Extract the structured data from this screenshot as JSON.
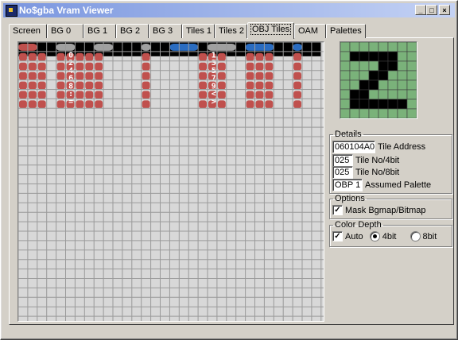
{
  "window": {
    "title": "No$gba Vram Viewer"
  },
  "titlebar_buttons": {
    "minimize": "_",
    "maximize": "□",
    "close": "×"
  },
  "tabs": [
    {
      "label": "Screen"
    },
    {
      "label": "BG 0"
    },
    {
      "label": "BG 1"
    },
    {
      "label": "BG 2"
    },
    {
      "label": "BG 3"
    },
    {
      "label": "Tiles 1"
    },
    {
      "label": "Tiles 2"
    },
    {
      "label": "OBJ Tiles"
    },
    {
      "label": "OAM"
    },
    {
      "label": "Palettes"
    }
  ],
  "active_tab": "OBJ Tiles",
  "details": {
    "legend": "Details",
    "tile_address": {
      "value": "060104A0",
      "label": "Tile Address"
    },
    "tile_no_4bit": {
      "value": "025",
      "label": "Tile No/4bit"
    },
    "tile_no_8bit": {
      "value": "025",
      "label": "Tile No/8bit"
    },
    "assumed_palette": {
      "value": "OBP 1",
      "label": "Assumed Palette"
    }
  },
  "options": {
    "legend": "Options",
    "mask_label": "Mask Bgmap/Bitmap",
    "mask_checked": true
  },
  "color_depth": {
    "legend": "Color Depth",
    "auto_label": "Auto",
    "auto_checked": true,
    "opt_4bit": "4bit",
    "opt_8bit": "8bit",
    "selected": "4bit"
  },
  "tile_glyphs": [
    "0",
    "1",
    "2",
    "3",
    "4",
    "5",
    "6",
    "7",
    "8",
    "9",
    ":",
    "<",
    "=",
    ">"
  ],
  "colors": {
    "grid_bg": "#d8d8d8",
    "grid_line": "#9a9a9a",
    "black": "#000000",
    "red": "#c0504d",
    "gray": "#a0a0a0",
    "blue": "#2a6cc0",
    "preview_green": "#7ab27a"
  }
}
